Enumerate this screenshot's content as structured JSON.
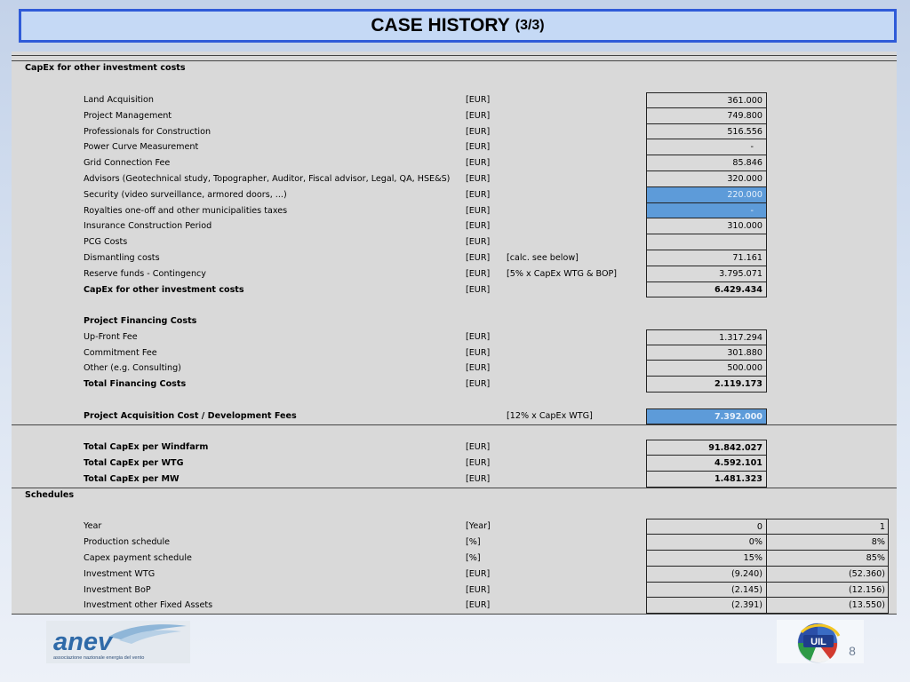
{
  "title": {
    "main": "CASE HISTORY",
    "sub": "(3/3)"
  },
  "capex_other": {
    "header": "CapEx for other investment costs",
    "rows": [
      {
        "label": "Land Acquisition",
        "unit": "[EUR]",
        "note": "",
        "value": "361.000",
        "highlight": false,
        "bold": false
      },
      {
        "label": "Project Management",
        "unit": "[EUR]",
        "note": "",
        "value": "749.800",
        "highlight": false,
        "bold": false
      },
      {
        "label": "Professionals for Construction",
        "unit": "[EUR]",
        "note": "",
        "value": "516.556",
        "highlight": false,
        "bold": false
      },
      {
        "label": "Power Curve Measurement",
        "unit": "[EUR]",
        "note": "",
        "value": "-",
        "highlight": false,
        "bold": false
      },
      {
        "label": "Grid Connection Fee",
        "unit": "[EUR]",
        "note": "",
        "value": "85.846",
        "highlight": false,
        "bold": false
      },
      {
        "label": "Advisors (Geotechnical study, Topographer, Auditor, Fiscal advisor, Legal, QA, HSE&S)",
        "unit": "[EUR]",
        "note": "",
        "value": "320.000",
        "highlight": false,
        "bold": false
      },
      {
        "label": "Security (video surveillance, armored doors, ...)",
        "unit": "[EUR]",
        "note": "",
        "value": "220.000",
        "highlight": true,
        "bold": false
      },
      {
        "label": "Royalties one-off and other municipalities taxes",
        "unit": "[EUR]",
        "note": "",
        "value": "-",
        "highlight": true,
        "bold": false
      },
      {
        "label": "Insurance Construction Period",
        "unit": "[EUR]",
        "note": "",
        "value": "310.000",
        "highlight": false,
        "bold": false
      },
      {
        "label": "PCG Costs",
        "unit": "[EUR]",
        "note": "",
        "value": "",
        "highlight": false,
        "bold": false
      },
      {
        "label": "Dismantling costs",
        "unit": "[EUR]",
        "note": "[calc. see below]",
        "value": "71.161",
        "highlight": false,
        "bold": false
      },
      {
        "label": "Reserve funds - Contingency",
        "unit": "[EUR]",
        "note": "[5% x CapEx WTG & BOP]",
        "value": "3.795.071",
        "highlight": false,
        "bold": false
      },
      {
        "label": "CapEx for other investment costs",
        "unit": "[EUR]",
        "note": "",
        "value": "6.429.434",
        "highlight": false,
        "bold": true
      }
    ]
  },
  "financing": {
    "header": "Project Financing Costs",
    "rows": [
      {
        "label": "Up-Front Fee",
        "unit": "[EUR]",
        "value": "1.317.294",
        "bold": false
      },
      {
        "label": "Commitment Fee",
        "unit": "[EUR]",
        "value": "301.880",
        "bold": false
      },
      {
        "label": "Other (e.g. Consulting)",
        "unit": "[EUR]",
        "value": "500.000",
        "bold": false
      },
      {
        "label": "Total Financing Costs",
        "unit": "[EUR]",
        "value": "2.119.173",
        "bold": true
      }
    ]
  },
  "acquisition": {
    "label": "Project Acquisition Cost / Development Fees",
    "note": "[12% x CapEx WTG]",
    "value": "7.392.000"
  },
  "totals": [
    {
      "label": "Total CapEx per Windfarm",
      "unit": "[EUR]",
      "value": "91.842.027"
    },
    {
      "label": "Total CapEx per WTG",
      "unit": "[EUR]",
      "value": "4.592.101"
    },
    {
      "label": "Total CapEx per MW",
      "unit": "[EUR]",
      "value": "1.481.323"
    }
  ],
  "schedules": {
    "header": "Schedules",
    "rows": [
      {
        "label": "Year",
        "unit": "[Year]",
        "v0": "0",
        "v1": "1"
      },
      {
        "label": "Production schedule",
        "unit": "[%]",
        "v0": "0%",
        "v1": "8%"
      },
      {
        "label": "Capex payment schedule",
        "unit": "[%]",
        "v0": "15%",
        "v1": "85%"
      },
      {
        "label": "Investment WTG",
        "unit": "[EUR]",
        "v0": "(9.240)",
        "v1": "(52.360)"
      },
      {
        "label": "Investment BoP",
        "unit": "[EUR]",
        "v0": "(2.145)",
        "v1": "(12.156)"
      },
      {
        "label": "Investment other Fixed Assets",
        "unit": "[EUR]",
        "v0": "(2.391)",
        "v1": "(13.550)"
      }
    ]
  },
  "footer": {
    "anev_logo_text": "anev",
    "anev_tagline": "associazione nazionale energia del vento",
    "uil_logo_text": "UIL",
    "page_number": "8"
  },
  "colors": {
    "title_border": "#2f5bd8",
    "title_fill": "#c5d9f5",
    "highlight_cell": "#5d9bd9",
    "sheet_bg": "#d9d9d9"
  }
}
